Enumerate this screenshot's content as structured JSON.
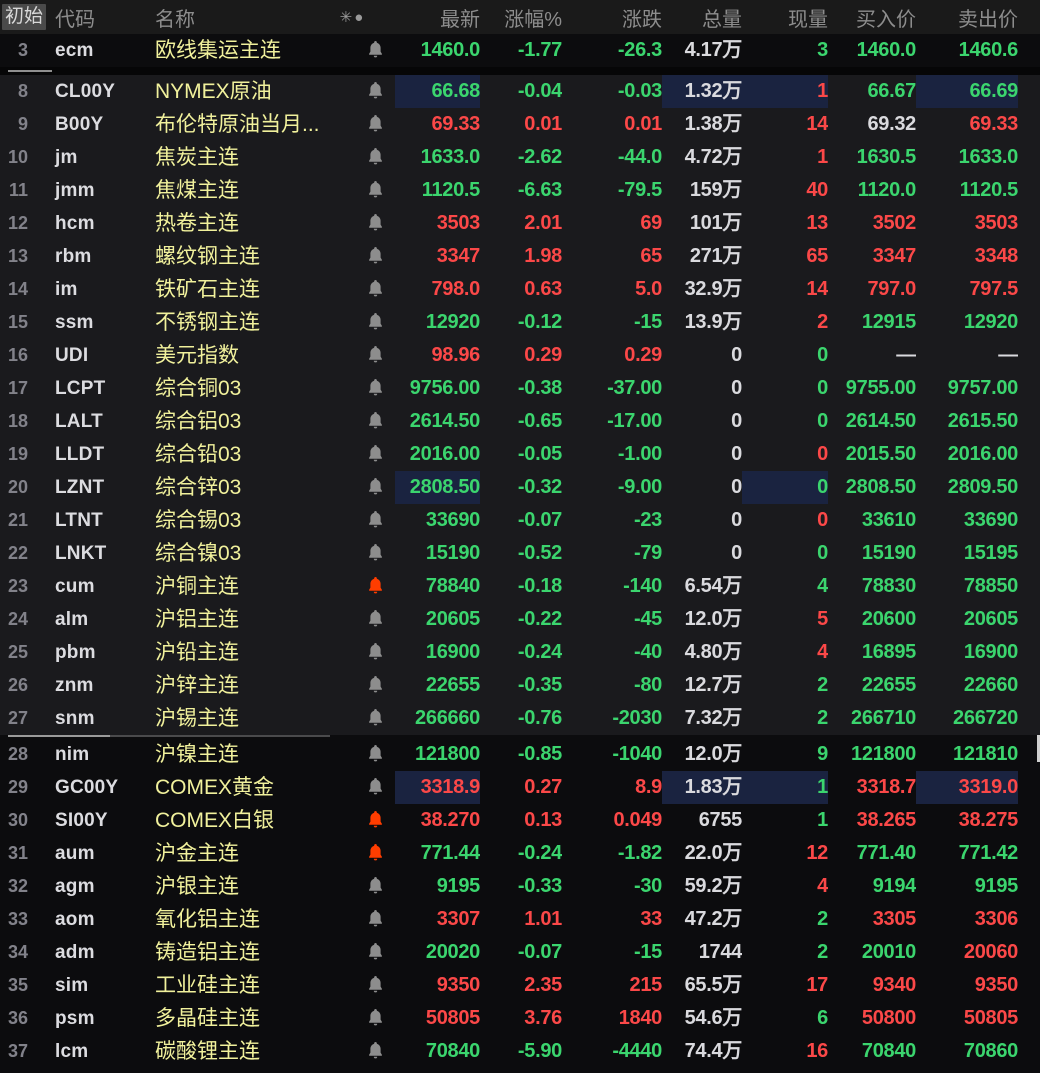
{
  "header": {
    "pin_label": "初始",
    "columns": [
      "代码",
      "名称",
      "最新",
      "涨幅%",
      "涨跌",
      "总量",
      "现量",
      "买入价",
      "卖出价"
    ],
    "sort_icons": "✳●"
  },
  "colors": {
    "up_red": "#fb4848",
    "down_green": "#3bd56e",
    "neutral_white": "#dadade",
    "name_yellow": "#f1f19c",
    "flash_navy": "#1a2340",
    "bell_orange": "#ff3d00",
    "bell_gray": "#8d8d8d"
  },
  "cell_keys": [
    "last",
    "pct",
    "chg",
    "vol",
    "cur",
    "bid",
    "ask"
  ],
  "sections": [
    {
      "id": "top",
      "rows": [
        {
          "num": "3",
          "code": "ecm",
          "name": "欧线集运主连",
          "bell": "gray",
          "vals": [
            "1460.0",
            "-1.77",
            "-26.3",
            "4.17万",
            "3",
            "1460.0",
            "1460.6"
          ],
          "cols": [
            "g",
            "g",
            "g",
            "w",
            "g",
            "g",
            "g"
          ],
          "flash": []
        }
      ]
    },
    {
      "id": "mid",
      "rows": [
        {
          "num": "8",
          "code": "CL00Y",
          "name": "NYMEX原油",
          "bell": "gray",
          "vals": [
            "66.68",
            "-0.04",
            "-0.03",
            "1.32万",
            "1",
            "66.67",
            "66.69"
          ],
          "cols": [
            "g",
            "g",
            "g",
            "w",
            "r",
            "g",
            "g"
          ],
          "flash": [
            "last",
            "vol",
            "cur",
            "ask"
          ]
        },
        {
          "num": "9",
          "code": "B00Y",
          "name": "布伦特原油当月...",
          "bell": "gray",
          "vals": [
            "69.33",
            "0.01",
            "0.01",
            "1.38万",
            "14",
            "69.32",
            "69.33"
          ],
          "cols": [
            "r",
            "r",
            "r",
            "w",
            "r",
            "w",
            "r"
          ],
          "flash": []
        },
        {
          "num": "10",
          "code": "jm",
          "name": "焦炭主连",
          "bell": "gray",
          "vals": [
            "1633.0",
            "-2.62",
            "-44.0",
            "4.72万",
            "1",
            "1630.5",
            "1633.0"
          ],
          "cols": [
            "g",
            "g",
            "g",
            "w",
            "r",
            "g",
            "g"
          ],
          "flash": []
        },
        {
          "num": "11",
          "code": "jmm",
          "name": "焦煤主连",
          "bell": "gray",
          "vals": [
            "1120.5",
            "-6.63",
            "-79.5",
            "159万",
            "40",
            "1120.0",
            "1120.5"
          ],
          "cols": [
            "g",
            "g",
            "g",
            "w",
            "r",
            "g",
            "g"
          ],
          "flash": []
        },
        {
          "num": "12",
          "code": "hcm",
          "name": "热卷主连",
          "bell": "gray",
          "vals": [
            "3503",
            "2.01",
            "69",
            "101万",
            "13",
            "3502",
            "3503"
          ],
          "cols": [
            "r",
            "r",
            "r",
            "w",
            "r",
            "r",
            "r"
          ],
          "flash": []
        },
        {
          "num": "13",
          "code": "rbm",
          "name": "螺纹钢主连",
          "bell": "gray",
          "vals": [
            "3347",
            "1.98",
            "65",
            "271万",
            "65",
            "3347",
            "3348"
          ],
          "cols": [
            "r",
            "r",
            "r",
            "w",
            "r",
            "r",
            "r"
          ],
          "flash": []
        },
        {
          "num": "14",
          "code": "im",
          "name": "铁矿石主连",
          "bell": "gray",
          "vals": [
            "798.0",
            "0.63",
            "5.0",
            "32.9万",
            "14",
            "797.0",
            "797.5"
          ],
          "cols": [
            "r",
            "r",
            "r",
            "w",
            "r",
            "r",
            "r"
          ],
          "flash": []
        },
        {
          "num": "15",
          "code": "ssm",
          "name": "不锈钢主连",
          "bell": "gray",
          "vals": [
            "12920",
            "-0.12",
            "-15",
            "13.9万",
            "2",
            "12915",
            "12920"
          ],
          "cols": [
            "g",
            "g",
            "g",
            "w",
            "r",
            "g",
            "g"
          ],
          "flash": []
        },
        {
          "num": "16",
          "code": "UDI",
          "name": "美元指数",
          "bell": "gray",
          "vals": [
            "98.96",
            "0.29",
            "0.29",
            "0",
            "0",
            "—",
            "—"
          ],
          "cols": [
            "r",
            "r",
            "r",
            "w",
            "g",
            "w",
            "w"
          ],
          "flash": []
        },
        {
          "num": "17",
          "code": "LCPT",
          "name": "综合铜03",
          "bell": "gray",
          "vals": [
            "9756.00",
            "-0.38",
            "-37.00",
            "0",
            "0",
            "9755.00",
            "9757.00"
          ],
          "cols": [
            "g",
            "g",
            "g",
            "w",
            "g",
            "g",
            "g"
          ],
          "flash": []
        },
        {
          "num": "18",
          "code": "LALT",
          "name": "综合铝03",
          "bell": "gray",
          "vals": [
            "2614.50",
            "-0.65",
            "-17.00",
            "0",
            "0",
            "2614.50",
            "2615.50"
          ],
          "cols": [
            "g",
            "g",
            "g",
            "w",
            "g",
            "g",
            "g"
          ],
          "flash": []
        },
        {
          "num": "19",
          "code": "LLDT",
          "name": "综合铅03",
          "bell": "gray",
          "vals": [
            "2016.00",
            "-0.05",
            "-1.00",
            "0",
            "0",
            "2015.50",
            "2016.00"
          ],
          "cols": [
            "g",
            "g",
            "g",
            "w",
            "r",
            "g",
            "g"
          ],
          "flash": []
        },
        {
          "num": "20",
          "code": "LZNT",
          "name": "综合锌03",
          "bell": "gray",
          "vals": [
            "2808.50",
            "-0.32",
            "-9.00",
            "0",
            "0",
            "2808.50",
            "2809.50"
          ],
          "cols": [
            "g",
            "g",
            "g",
            "w",
            "g",
            "g",
            "g"
          ],
          "flash": [
            "last",
            "cur"
          ]
        },
        {
          "num": "21",
          "code": "LTNT",
          "name": "综合锡03",
          "bell": "gray",
          "vals": [
            "33690",
            "-0.07",
            "-23",
            "0",
            "0",
            "33610",
            "33690"
          ],
          "cols": [
            "g",
            "g",
            "g",
            "w",
            "r",
            "g",
            "g"
          ],
          "flash": []
        },
        {
          "num": "22",
          "code": "LNKT",
          "name": "综合镍03",
          "bell": "gray",
          "vals": [
            "15190",
            "-0.52",
            "-79",
            "0",
            "0",
            "15190",
            "15195"
          ],
          "cols": [
            "g",
            "g",
            "g",
            "w",
            "g",
            "g",
            "g"
          ],
          "flash": []
        },
        {
          "num": "23",
          "code": "cum",
          "name": "沪铜主连",
          "bell": "orange",
          "vals": [
            "78840",
            "-0.18",
            "-140",
            "6.54万",
            "4",
            "78830",
            "78850"
          ],
          "cols": [
            "g",
            "g",
            "g",
            "w",
            "g",
            "g",
            "g"
          ],
          "flash": []
        },
        {
          "num": "24",
          "code": "alm",
          "name": "沪铝主连",
          "bell": "gray",
          "vals": [
            "20605",
            "-0.22",
            "-45",
            "12.0万",
            "5",
            "20600",
            "20605"
          ],
          "cols": [
            "g",
            "g",
            "g",
            "w",
            "r",
            "g",
            "g"
          ],
          "flash": []
        },
        {
          "num": "25",
          "code": "pbm",
          "name": "沪铅主连",
          "bell": "gray",
          "vals": [
            "16900",
            "-0.24",
            "-40",
            "4.80万",
            "4",
            "16895",
            "16900"
          ],
          "cols": [
            "g",
            "g",
            "g",
            "w",
            "r",
            "g",
            "g"
          ],
          "flash": []
        },
        {
          "num": "26",
          "code": "znm",
          "name": "沪锌主连",
          "bell": "gray",
          "vals": [
            "22655",
            "-0.35",
            "-80",
            "12.7万",
            "2",
            "22655",
            "22660"
          ],
          "cols": [
            "g",
            "g",
            "g",
            "w",
            "g",
            "g",
            "g"
          ],
          "flash": []
        },
        {
          "num": "27",
          "code": "snm",
          "name": "沪锡主连",
          "bell": "gray",
          "vals": [
            "266660",
            "-0.76",
            "-2030",
            "7.32万",
            "2",
            "266710",
            "266720"
          ],
          "cols": [
            "g",
            "g",
            "g",
            "w",
            "g",
            "g",
            "g"
          ],
          "flash": []
        }
      ]
    },
    {
      "id": "bottom",
      "rows": [
        {
          "num": "28",
          "code": "nim",
          "name": "沪镍主连",
          "bell": "gray",
          "vals": [
            "121800",
            "-0.85",
            "-1040",
            "12.0万",
            "9",
            "121800",
            "121810"
          ],
          "cols": [
            "g",
            "g",
            "g",
            "w",
            "g",
            "g",
            "g"
          ],
          "flash": []
        },
        {
          "num": "29",
          "code": "GC00Y",
          "name": "COMEX黄金",
          "bell": "gray",
          "vals": [
            "3318.9",
            "0.27",
            "8.9",
            "1.83万",
            "1",
            "3318.7",
            "3319.0"
          ],
          "cols": [
            "r",
            "r",
            "r",
            "w",
            "g",
            "r",
            "r"
          ],
          "flash": [
            "last",
            "vol",
            "cur",
            "ask"
          ]
        },
        {
          "num": "30",
          "code": "SI00Y",
          "name": "COMEX白银",
          "bell": "orange",
          "vals": [
            "38.270",
            "0.13",
            "0.049",
            "6755",
            "1",
            "38.265",
            "38.275"
          ],
          "cols": [
            "r",
            "r",
            "r",
            "w",
            "g",
            "r",
            "r"
          ],
          "flash": []
        },
        {
          "num": "31",
          "code": "aum",
          "name": "沪金主连",
          "bell": "orange",
          "vals": [
            "771.44",
            "-0.24",
            "-1.82",
            "22.0万",
            "12",
            "771.40",
            "771.42"
          ],
          "cols": [
            "g",
            "g",
            "g",
            "w",
            "r",
            "g",
            "g"
          ],
          "flash": []
        },
        {
          "num": "32",
          "code": "agm",
          "name": "沪银主连",
          "bell": "gray",
          "vals": [
            "9195",
            "-0.33",
            "-30",
            "59.2万",
            "4",
            "9194",
            "9195"
          ],
          "cols": [
            "g",
            "g",
            "g",
            "w",
            "r",
            "g",
            "g"
          ],
          "flash": []
        },
        {
          "num": "33",
          "code": "aom",
          "name": "氧化铝主连",
          "bell": "gray",
          "vals": [
            "3307",
            "1.01",
            "33",
            "47.2万",
            "2",
            "3305",
            "3306"
          ],
          "cols": [
            "r",
            "r",
            "r",
            "w",
            "g",
            "r",
            "r"
          ],
          "flash": []
        },
        {
          "num": "34",
          "code": "adm",
          "name": "铸造铝主连",
          "bell": "gray",
          "vals": [
            "20020",
            "-0.07",
            "-15",
            "1744",
            "2",
            "20010",
            "20060"
          ],
          "cols": [
            "g",
            "g",
            "g",
            "w",
            "g",
            "g",
            "r"
          ],
          "flash": []
        },
        {
          "num": "35",
          "code": "sim",
          "name": "工业硅主连",
          "bell": "gray",
          "vals": [
            "9350",
            "2.35",
            "215",
            "65.5万",
            "17",
            "9340",
            "9350"
          ],
          "cols": [
            "r",
            "r",
            "r",
            "w",
            "r",
            "r",
            "r"
          ],
          "flash": []
        },
        {
          "num": "36",
          "code": "psm",
          "name": "多晶硅主连",
          "bell": "gray",
          "vals": [
            "50805",
            "3.76",
            "1840",
            "54.6万",
            "6",
            "50800",
            "50805"
          ],
          "cols": [
            "r",
            "r",
            "r",
            "w",
            "g",
            "r",
            "r"
          ],
          "flash": []
        },
        {
          "num": "37",
          "code": "lcm",
          "name": "碳酸锂主连",
          "bell": "gray",
          "vals": [
            "70840",
            "-5.90",
            "-4440",
            "74.4万",
            "16",
            "70840",
            "70860"
          ],
          "cols": [
            "g",
            "g",
            "g",
            "w",
            "r",
            "g",
            "g"
          ],
          "flash": []
        }
      ]
    }
  ]
}
